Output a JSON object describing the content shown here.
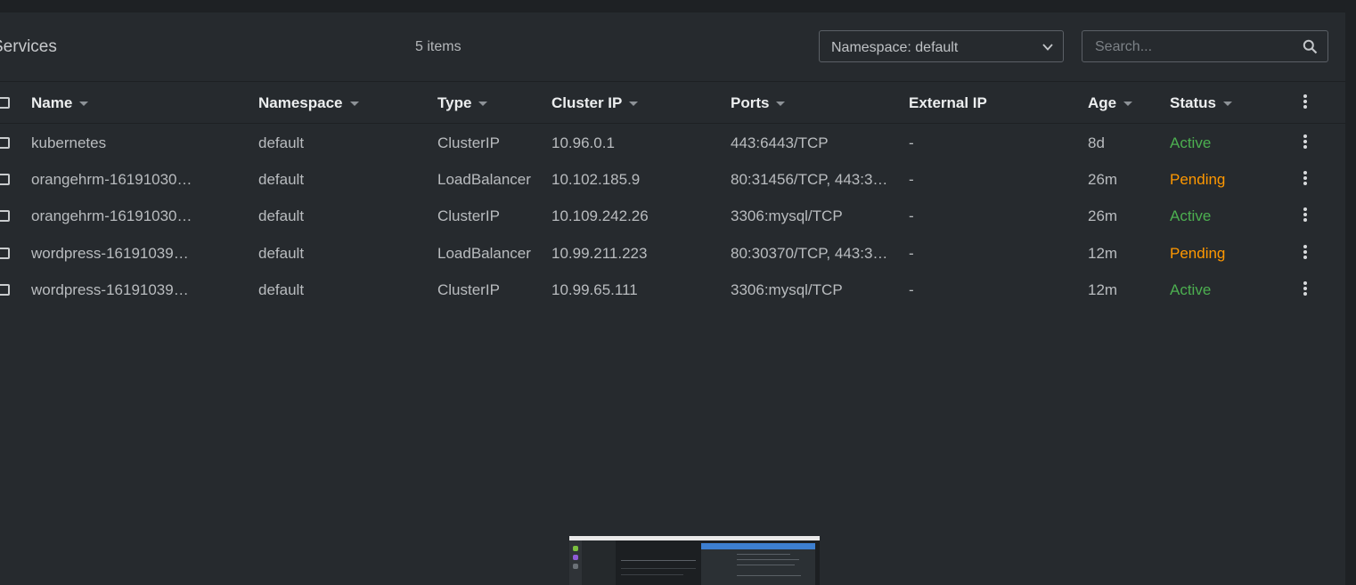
{
  "page": {
    "title": "Services",
    "item_count": "5 items"
  },
  "filters": {
    "namespace_label": "Namespace: default",
    "search_placeholder": "Search..."
  },
  "table": {
    "columns": {
      "name": "Name",
      "namespace": "Namespace",
      "type": "Type",
      "cluster_ip": "Cluster IP",
      "ports": "Ports",
      "external_ip": "External IP",
      "age": "Age",
      "status": "Status"
    },
    "rows": [
      {
        "name": "kubernetes",
        "namespace": "default",
        "type": "ClusterIP",
        "cluster_ip": "10.96.0.1",
        "ports": "443:6443/TCP",
        "external_ip": "-",
        "age": "8d",
        "status": "Active"
      },
      {
        "name": "orangehrm-16191030…",
        "namespace": "default",
        "type": "LoadBalancer",
        "cluster_ip": "10.102.185.9",
        "ports": "80:31456/TCP, 443:3…",
        "external_ip": "-",
        "age": "26m",
        "status": "Pending"
      },
      {
        "name": "orangehrm-16191030…",
        "namespace": "default",
        "type": "ClusterIP",
        "cluster_ip": "10.109.242.26",
        "ports": "3306:mysql/TCP",
        "external_ip": "-",
        "age": "26m",
        "status": "Active"
      },
      {
        "name": "wordpress-16191039…",
        "namespace": "default",
        "type": "LoadBalancer",
        "cluster_ip": "10.99.211.223",
        "ports": "80:30370/TCP, 443:3…",
        "external_ip": "-",
        "age": "12m",
        "status": "Pending"
      },
      {
        "name": "wordpress-16191039…",
        "namespace": "default",
        "type": "ClusterIP",
        "cluster_ip": "10.99.65.111",
        "ports": "3306:mysql/TCP",
        "external_ip": "-",
        "age": "12m",
        "status": "Active"
      }
    ]
  },
  "icons": {
    "namespace_dropdown": "chevron-down-icon",
    "search": "search-icon",
    "row_menu": "more-vertical-icon"
  },
  "colors": {
    "background": "#262a2e",
    "status_active": "#4caf50",
    "status_pending": "#ff9800"
  }
}
